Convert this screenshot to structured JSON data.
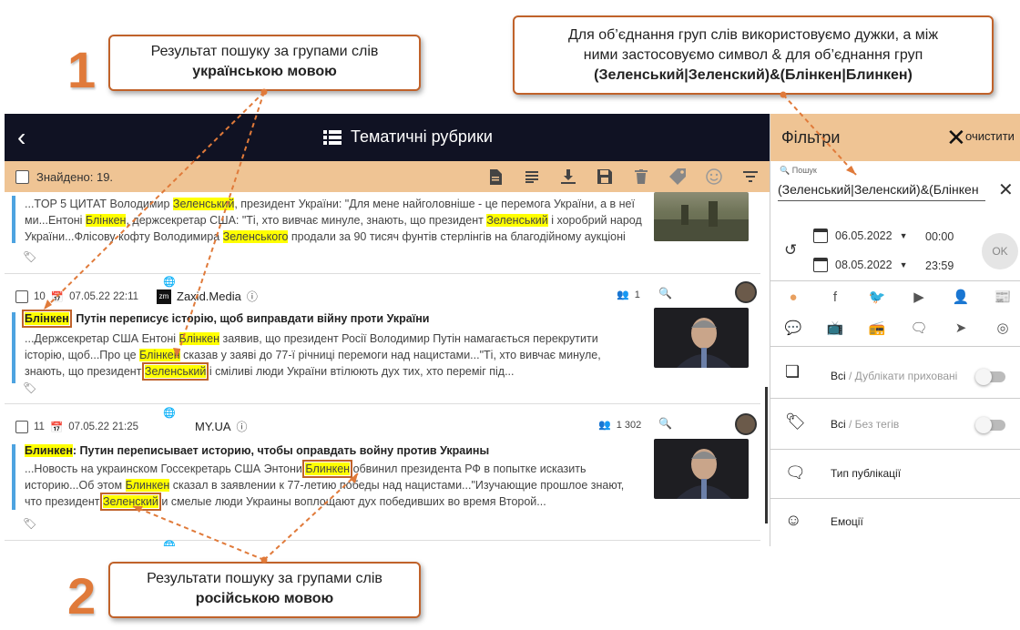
{
  "callouts": {
    "one_number": "1",
    "one_text": "Результат пошуку за групами слів",
    "one_bold": "українською мовою",
    "two_number": "2",
    "two_text": "Результати пошуку за групами слів",
    "two_bold": "російською мовою",
    "top_line1": "Для об’єднання груп слів використовуємо дужки, а між",
    "top_line2": "ними застосовуємо символ & для об’єднання груп",
    "top_bold": "(Зеленський|Зеленский)&(Блінкен|Блинкен)"
  },
  "header": {
    "title": "Тематичні рубрики",
    "found": "Знайдено: 19."
  },
  "articles": [
    {
      "lines": [
        [
          "...TOP 5 ЦИТАТ Володимир ",
          "Зеленський",
          ", президент України: \"Для мене найголовніше - це перемога України, а в неї"
        ],
        [
          "ми...Ентоні ",
          "Блінкен",
          ", держсекретар США: \"Ті, хто вивчає минуле, знають, що президент ",
          "Зеленський",
          " і хоробрий народ"
        ],
        [
          "України...Флісову кофту Володимира ",
          "Зеленського",
          " продали за 90 тисяч фунтів стерлінгів на благодійному аукціоні"
        ]
      ]
    },
    {
      "num": "10",
      "date": "07.05.22 22:11",
      "source": "Zaxid.Media",
      "reach": "1",
      "head_hl": "Блінкен",
      "head_rest": ": Путін переписує історію, щоб виправдати війну проти України",
      "l1a": "...Держсекретар США Ентоні ",
      "l1b": "Блінкен",
      "l1c": " заявив, що президент Росії Володимир Путін намагається перекрутити",
      "l2a": "історію, щоб...Про це ",
      "l2b": "Блінкен",
      "l2c": " сказав у заяві до 77-ї річниці перемоги над нацистами...\"Ті, хто вивчає минуле,",
      "l3a": "знають, що президент ",
      "l3b": "Зеленський",
      "l3c": " і сміливі люди України втілюють дух тих, хто переміг під..."
    },
    {
      "num": "11",
      "date": "07.05.22 21:25",
      "source": "MY.UA",
      "reach": "1 302",
      "head_hl": "Блинкен",
      "head_rest": ": Путин переписывает историю, чтобы оправдать войну против Украины",
      "l1a": "...Новость на украинском Госсекретарь США Энтони ",
      "l1b": "Блинкен",
      "l1c": " обвинил президента РФ в попытке исказить",
      "l2a": "историю...Об этом ",
      "l2b": "Блинкен",
      "l2c": " сказал в заявлении к 77-летию победы над нацистами...\"Изучающие прошлое знают,",
      "l3a": "что президент ",
      "l3b": "Зеленский",
      "l3c": " и смелые люди Украины воплощают дух победивших во время Второй..."
    }
  ],
  "filters": {
    "title": "Фільтри",
    "clear": "очистити",
    "search_label": "Пошук",
    "search_value": "(Зеленський|Зеленский)&(Блінкен",
    "date_from": "06.05.2022",
    "time_from": "00:00",
    "date_to": "08.05.2022",
    "time_to": "23:59",
    "ok": "OK",
    "dup_main": "Всі",
    "dup_sub": " / Дублікати приховані",
    "tags_main": "Всі",
    "tags_sub": " / Без тегів",
    "pub_type": "Тип публікації",
    "emotions": "Емоції"
  },
  "colors": {
    "accent": "#efc494",
    "header_bg": "#101223",
    "highlight": "#ffff00",
    "callout_border": "#c0622a"
  }
}
